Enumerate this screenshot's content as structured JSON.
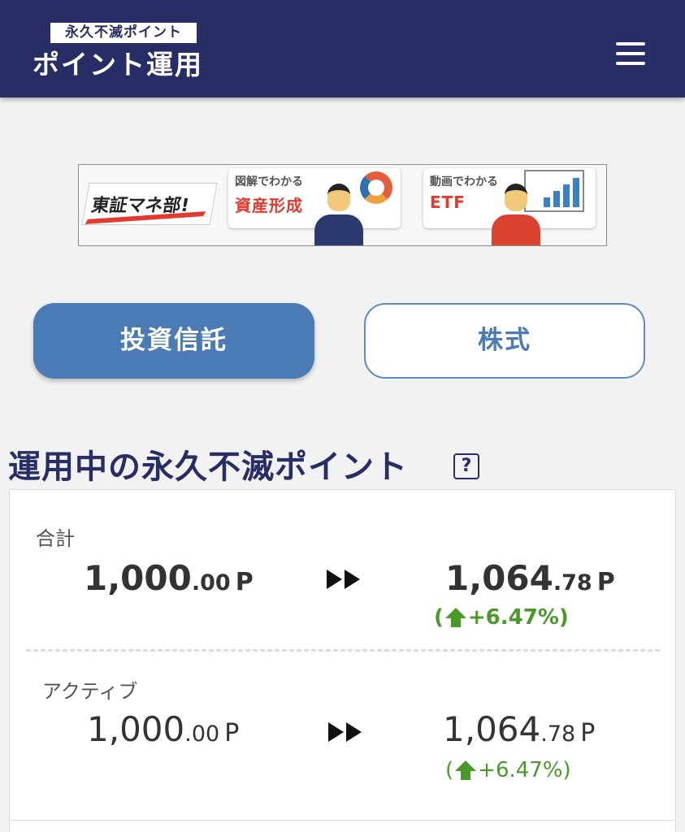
{
  "header": {
    "logo_top": "永久不滅ポイント",
    "logo_main": "ポイント運用",
    "menu_icon": "hamburger-menu-icon",
    "background": "#292d66"
  },
  "banner": {
    "brand": "東証マネ部!",
    "card1_small": "図解でわかる",
    "card1_big": "資産形成",
    "card2_small": "動画でわかる",
    "card2_big": "ETF"
  },
  "tabs": [
    {
      "label": "投資信託",
      "active": true
    },
    {
      "label": "株式",
      "active": false
    }
  ],
  "section": {
    "title": "運用中の永久不滅ポイント",
    "help_icon": "question-icon",
    "help_glyph": "?"
  },
  "rows": [
    {
      "label": "合計",
      "from_int": "1,000",
      "from_dec": ".00",
      "unit": "P",
      "to_int": "1,064",
      "to_dec": ".78",
      "change_open": "(",
      "change_value": "+6.47%)"
    },
    {
      "label": "アクティブ",
      "from_int": "1,000",
      "from_dec": ".00",
      "unit": "P",
      "to_int": "1,064",
      "to_dec": ".78",
      "change_open": "(",
      "change_value": "+6.47%)"
    }
  ],
  "colors": {
    "accent": "#4a7bb5",
    "navy": "#292d66",
    "positive": "#4a9a2a"
  }
}
